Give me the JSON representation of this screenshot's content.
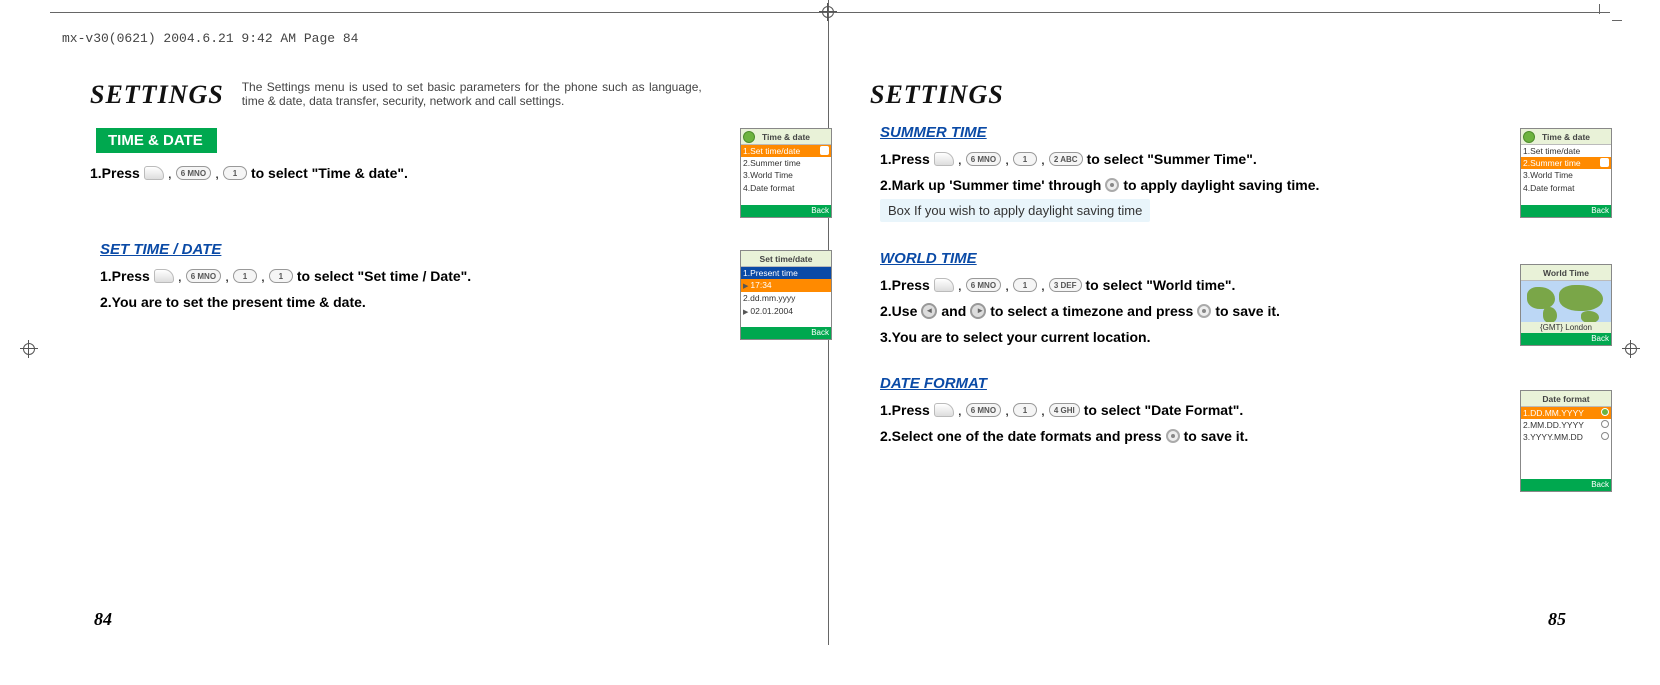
{
  "print_header": "mx-v30(0621)  2004.6.21  9:42 AM  Page 84",
  "page_numbers": {
    "left": "84",
    "right": "85"
  },
  "left": {
    "heading": "SETTINGS",
    "description": "The Settings menu is used to set basic parameters for the phone such as language, time & date, data transfer, security, network and call settings.",
    "section_title": "TIME & DATE",
    "step1_a": "1.Press",
    "step1_b": "to select \"Time & date\".",
    "keys1": [
      "6 MNO",
      "1"
    ],
    "sub1": {
      "title": "SET TIME / DATE",
      "step1_a": "1.Press",
      "step1_b": "to select \"Set time / Date\".",
      "keys": [
        "6 MNO",
        "1",
        "1"
      ],
      "step2": "2.You are to set the present time & date."
    },
    "phone1": {
      "title": "Time & date",
      "rows": [
        "1.Set time/date",
        "2.Summer time",
        "3.World Time",
        "4.Date format"
      ],
      "selected": 0,
      "footer": "Back"
    },
    "phone2": {
      "title": "Set time/date",
      "bluebar": "1.Present time",
      "rows_arrow": [
        "17:34",
        "dd.mm.yyyy",
        "02.01.2004"
      ],
      "prefix_row": "2.",
      "footer": "Back"
    }
  },
  "right": {
    "heading": "SETTINGS",
    "summer": {
      "title": "SUMMER TIME",
      "step1_a": "1.Press",
      "step1_b": "to select \"Summer Time\".",
      "keys": [
        "6 MNO",
        "1",
        "2 ABC"
      ],
      "step2_a": "2.Mark up 'Summer time' through",
      "step2_b": "to apply daylight saving time.",
      "note": "Box If you wish to apply daylight saving time"
    },
    "world": {
      "title": "WORLD TIME",
      "step1_a": "1.Press",
      "step1_b": "to select \"World time\".",
      "keys": [
        "6 MNO",
        "1",
        "3 DEF"
      ],
      "step2_a": "2.Use",
      "step2_b": "and",
      "step2_c": "to select a timezone and press",
      "step2_d": "to save it.",
      "step3": "3.You are to select your current location."
    },
    "dateformat": {
      "title": "DATE FORMAT",
      "step1_a": "1.Press",
      "step1_b": "to select \"Date Format\".",
      "keys": [
        "6 MNO",
        "1",
        "4 GHI"
      ],
      "step2_a": "2.Select one of the date formats and press",
      "step2_b": "to save it."
    },
    "phone3": {
      "title": "Time & date",
      "rows": [
        "1.Set time/date",
        "2.Summer time",
        "3.World Time",
        "4.Date format"
      ],
      "selected": 1,
      "footer": "Back"
    },
    "phone4": {
      "title": "World Time",
      "caption": "{GMT} London",
      "footer": "Back"
    },
    "phone5": {
      "title": "Date format",
      "rows": [
        "1.DD.MM.YYYY",
        "2.MM.DD.YYYY",
        "3.YYYY.MM.DD"
      ],
      "selected": 0,
      "footer": "Back"
    }
  }
}
